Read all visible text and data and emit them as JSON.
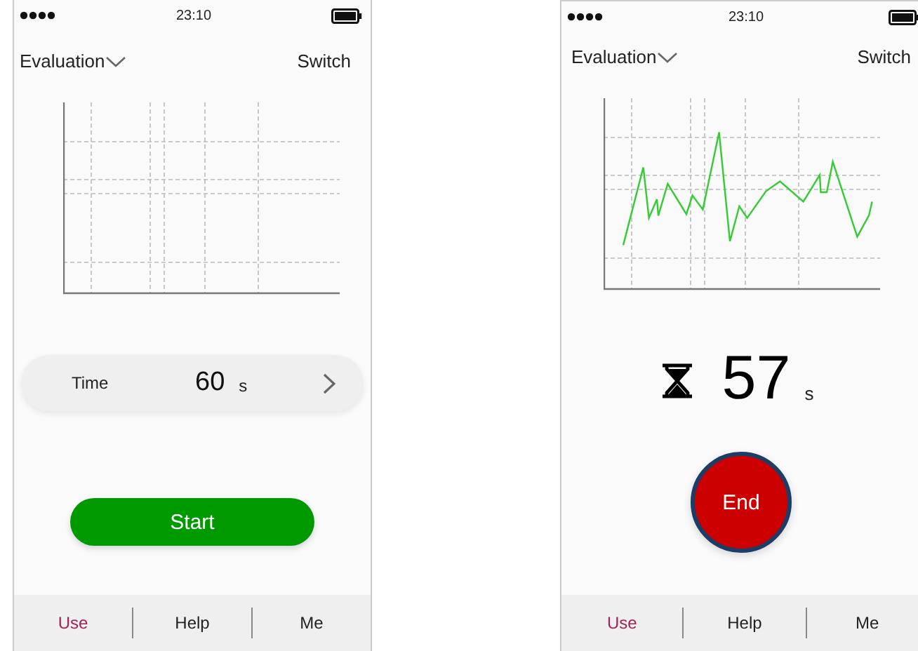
{
  "screens": [
    {
      "kind": "setup",
      "status_bar": {
        "time": "23:10"
      },
      "header": {
        "title": "Evaluation",
        "action": "Switch"
      },
      "time_setting": {
        "label": "Time",
        "value": "60",
        "unit": "s"
      },
      "button": "Start",
      "tabs": [
        {
          "label": "Use",
          "selected": true
        },
        {
          "label": "Help",
          "selected": false
        },
        {
          "label": "Me",
          "selected": false
        }
      ]
    },
    {
      "kind": "running",
      "status_bar": {
        "time": "23:10"
      },
      "header": {
        "title": "Evaluation",
        "action": "Switch"
      },
      "timer": {
        "value": "57",
        "unit": "s"
      },
      "button": "End",
      "tabs": [
        {
          "label": "Use",
          "selected": true
        },
        {
          "label": "Help",
          "selected": false
        },
        {
          "label": "Me",
          "selected": false
        }
      ]
    }
  ]
}
